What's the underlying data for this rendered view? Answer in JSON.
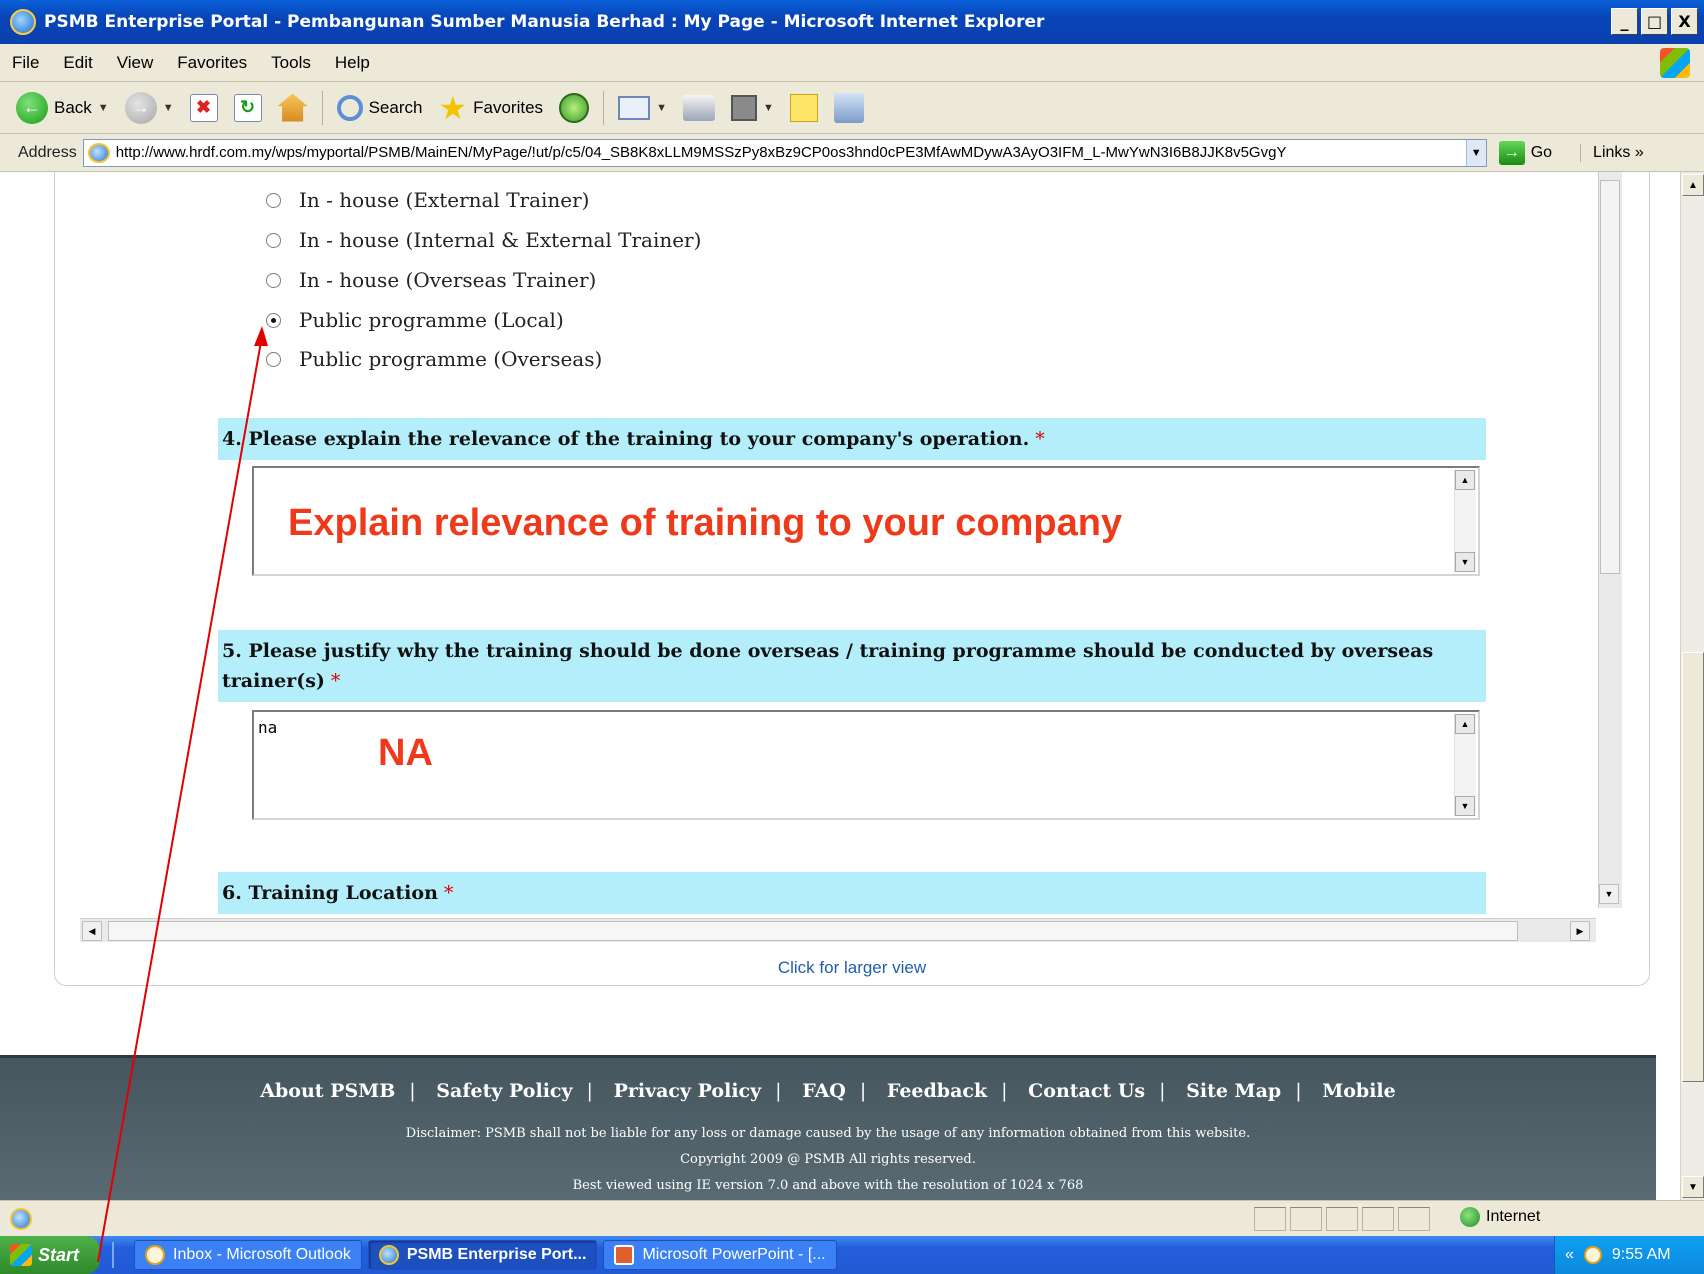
{
  "window": {
    "title": "PSMB Enterprise Portal - Pembangunan Sumber Manusia Berhad : My Page - Microsoft Internet Explorer",
    "minimize": "_",
    "maximize": "&#x25A1;",
    "close": "X"
  },
  "menu": [
    "File",
    "Edit",
    "View",
    "Favorites",
    "Tools",
    "Help"
  ],
  "toolbar": {
    "back_label": "Back",
    "search_label": "Search",
    "favorites_label": "Favorites"
  },
  "address": {
    "label": "Address",
    "url": "http://www.hrdf.com.my/wps/myportal/PSMB/MainEN/MyPage/!ut/p/c5/04_SB8K8xLLM9MSSzPy8xBz9CP0os3hnd0cPE3MfAwMDywA3AyO3IFM_L-MwYwN3I6B8JJK8v5GvgY",
    "go_label": "Go",
    "links_label": "Links"
  },
  "form": {
    "options": [
      {
        "label": "In - house (External Trainer)",
        "checked": false
      },
      {
        "label": "In - house (Internal & External Trainer)",
        "checked": false
      },
      {
        "label": "In - house (Overseas Trainer)",
        "checked": false
      },
      {
        "label": "Public programme (Local)",
        "checked": true
      },
      {
        "label": "Public programme (Overseas)",
        "checked": false
      }
    ],
    "q4": {
      "text": "4. Please explain the relevance of the training to your company's operation.",
      "required": "*",
      "value": ""
    },
    "q5": {
      "text": "5. Please justify why the training should be done overseas / training programme should be conducted by overseas trainer(s)",
      "required": "*",
      "value": "na"
    },
    "q6": {
      "text": "6. Training Location",
      "required": "*"
    }
  },
  "annotations": {
    "q4_note": "Explain relevance of training  to your company",
    "q5_note": "NA",
    "arrow_color": "#e00000"
  },
  "larger_view": "Click for larger view",
  "footer": {
    "links": [
      "About PSMB",
      "Safety Policy",
      "Privacy Policy",
      "FAQ",
      "Feedback",
      "Contact Us",
      "Site Map",
      "Mobile"
    ],
    "separator": "|",
    "disclaimer": "Disclaimer: PSMB shall not be liable for any loss or damage caused by the usage of any information obtained from this website.",
    "copyright": "Copyright 2009 @ PSMB All rights reserved.",
    "best_viewed": "Best viewed using IE version 7.0 and above with the resolution of 1024 x 768"
  },
  "status": {
    "zone": "Internet"
  },
  "taskbar": {
    "start": "Start",
    "tasks": [
      {
        "label": "Inbox - Microsoft Outlook",
        "active": false
      },
      {
        "label": "PSMB Enterprise Port...",
        "active": true
      },
      {
        "label": "Microsoft PowerPoint - [...",
        "active": false
      }
    ],
    "tray_chevron": "«",
    "clock": "9:55 AM"
  },
  "colors": {
    "question_bar": "#b4eefa",
    "note": "#ee3a1b",
    "footer": "#4e5e66"
  }
}
